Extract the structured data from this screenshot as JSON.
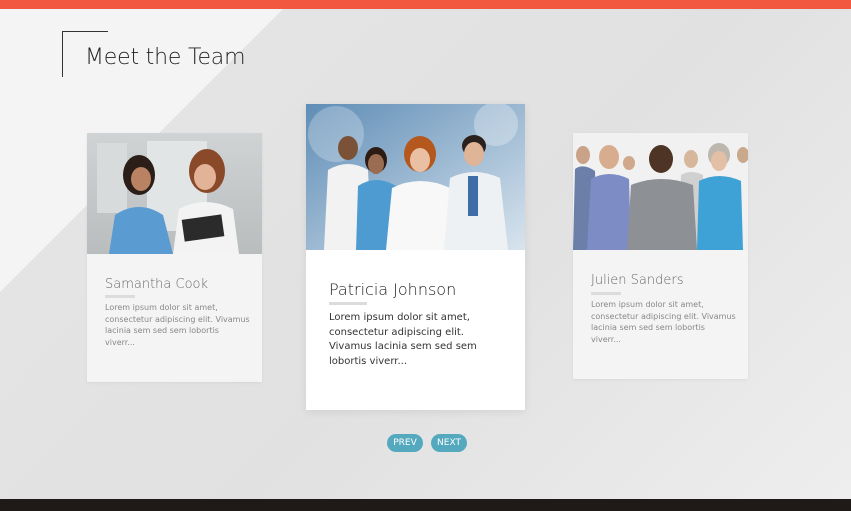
{
  "section": {
    "title": "Meet the Team"
  },
  "team": [
    {
      "name": "Samantha Cook",
      "description": "Lorem ipsum dolor sit amet, consectetur adipiscing elit. Vivamus lacinia sem sed sem lobortis viverr..."
    },
    {
      "name": "Patricia Johnson",
      "description": "Lorem ipsum dolor sit amet, consectetur adipiscing elit. Vivamus lacinia sem sed sem lobortis viverr..."
    },
    {
      "name": "Julien Sanders",
      "description": "Lorem ipsum dolor sit amet, consectetur adipiscing elit. Vivamus lacinia sem sed sem lobortis viverr..."
    }
  ],
  "nav": {
    "prev_label": "PREV",
    "next_label": "NEXT"
  },
  "colors": {
    "accent_bar": "#f2573f",
    "button": "#55a9bf"
  }
}
